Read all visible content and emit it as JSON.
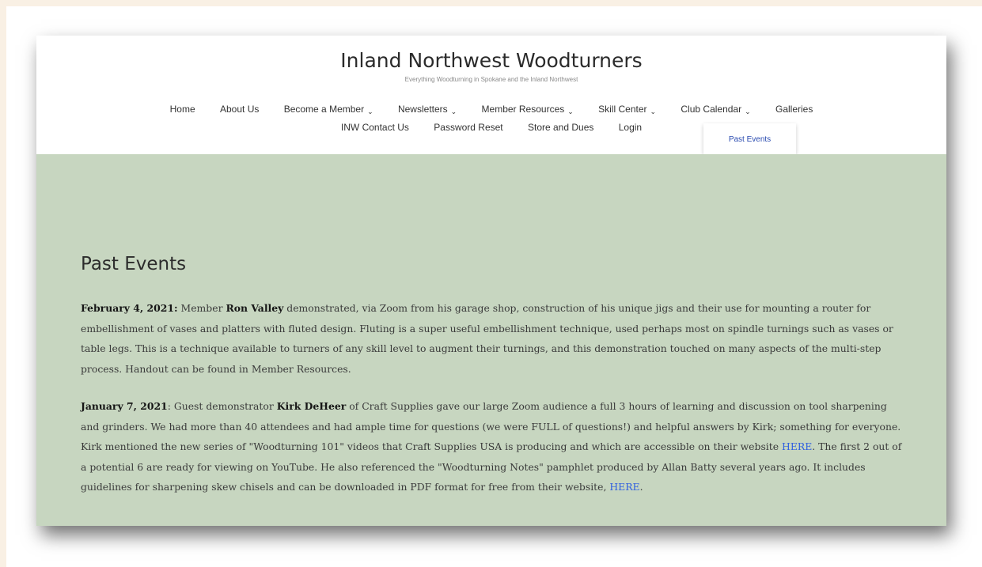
{
  "site": {
    "title": "Inland Northwest Woodturners",
    "tagline": "Everything Woodturning in Spokane and the Inland Northwest"
  },
  "nav": {
    "home": "Home",
    "about": "About Us",
    "become_member": "Become a Member",
    "newsletters": "Newsletters",
    "member_resources": "Member Resources",
    "skill_center": "Skill Center",
    "club_calendar": "Club Calendar",
    "galleries": "Galleries",
    "contact": "INW Contact Us",
    "password_reset": "Password Reset",
    "store_dues": "Store and Dues",
    "login": "Login",
    "dropdown_chevron": "chevron-down-icon",
    "dropdown_item": "Past Events"
  },
  "page": {
    "title": "Past Events",
    "events": [
      {
        "date": "February 4, 2021:",
        "t1": " Member ",
        "name": "Ron Valley",
        "t2": " demonstrated, via Zoom from his garage shop, construction of his unique jigs and their use for mounting a router for embellishment of vases and platters with fluted design. Fluting is a super useful embellishment technique, used perhaps most on spindle turnings such as vases or table legs. This is a technique available to turners of any skill level to augment their turnings, and this demonstration touched on many aspects of the multi-step process. Handout can be found in Member Resources."
      },
      {
        "date": "January 7, 2021",
        "t1": ":  Guest demonstrator ",
        "name": "Kirk DeHeer",
        "t2": " of Craft Supplies gave our large Zoom audience a full 3 hours of learning and discussion on tool sharpening and grinders.  We had more than 40 attendees and had ample time for questions (we were FULL of questions!) and helpful answers by Kirk; something for everyone. Kirk mentioned the new series of \"Woodturning 101\" videos that Craft Supplies USA is producing and which are accessible on their website ",
        "link1": "HERE",
        "t3": ". The first 2 out of a potential 6 are ready for viewing on YouTube. He also referenced the \"Woodturning Notes\" pamphlet produced by Allan Batty several years ago. It includes guidelines for sharpening skew chisels and can be downloaded in PDF format for free from their website, ",
        "link2": "HERE",
        "t4": "."
      }
    ]
  },
  "colors": {
    "page_background": "#f9f0e4",
    "content_background": "#c7d6c0",
    "link": "#2f5fe0"
  }
}
